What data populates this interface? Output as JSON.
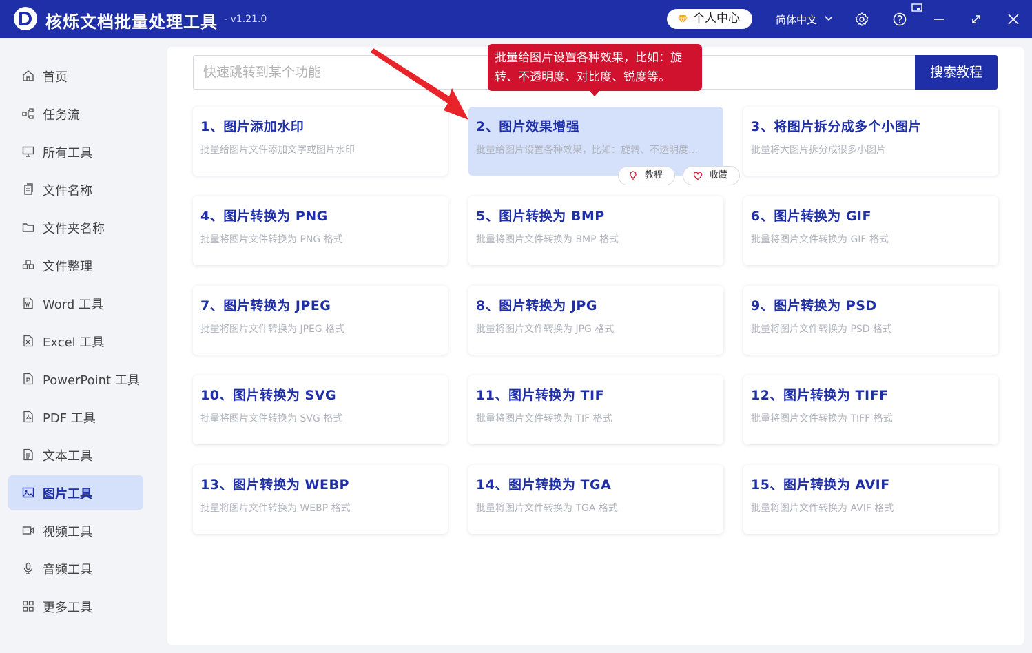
{
  "app": {
    "title": "核烁文档批量处理工具",
    "version": "- v1.21.0",
    "user_center": "个人中心",
    "language": "简体中文"
  },
  "sidebar": {
    "items": [
      {
        "label": "首页",
        "icon": "home-icon"
      },
      {
        "label": "任务流",
        "icon": "workflow-icon"
      },
      {
        "label": "所有工具",
        "icon": "monitor-icon"
      },
      {
        "label": "文件名称",
        "icon": "file-copy-icon"
      },
      {
        "label": "文件夹名称",
        "icon": "folder-icon"
      },
      {
        "label": "文件整理",
        "icon": "organize-icon"
      },
      {
        "label": "Word 工具",
        "icon": "word-icon"
      },
      {
        "label": "Excel 工具",
        "icon": "excel-icon"
      },
      {
        "label": "PowerPoint 工具",
        "icon": "powerpoint-icon"
      },
      {
        "label": "PDF 工具",
        "icon": "pdf-icon"
      },
      {
        "label": "文本工具",
        "icon": "text-icon"
      },
      {
        "label": "图片工具",
        "icon": "image-icon",
        "active": true
      },
      {
        "label": "视频工具",
        "icon": "video-icon"
      },
      {
        "label": "音频工具",
        "icon": "mic-icon"
      },
      {
        "label": "更多工具",
        "icon": "grid-icon"
      }
    ]
  },
  "search": {
    "placeholder": "快速跳转到某个功能",
    "button_label": "搜索教程"
  },
  "tooltip": {
    "line1": "批量给图片设置各种效果，比如：旋",
    "line2": "转、不透明度、对比度、锐度等。"
  },
  "card_actions": {
    "tutorial": "教程",
    "favorite": "收藏"
  },
  "tools": [
    {
      "title": "1、图片添加水印",
      "desc": "批量给图片文件添加文字或图片水印"
    },
    {
      "title": "2、图片效果增强",
      "desc": "批量给图片设置各种效果，比如：旋转、不透明度…",
      "active": true
    },
    {
      "title": "3、将图片拆分成多个小图片",
      "desc": "批量将大图片拆分成很多小图片"
    },
    {
      "title": "4、图片转换为 PNG",
      "desc": "批量将图片文件转换为 PNG 格式"
    },
    {
      "title": "5、图片转换为 BMP",
      "desc": "批量将图片文件转换为 BMP 格式"
    },
    {
      "title": "6、图片转换为 GIF",
      "desc": "批量将图片文件转换为 GIF 格式"
    },
    {
      "title": "7、图片转换为 JPEG",
      "desc": "批量将图片文件转换为 JPEG 格式"
    },
    {
      "title": "8、图片转换为 JPG",
      "desc": "批量将图片文件转换为 JPG 格式"
    },
    {
      "title": "9、图片转换为 PSD",
      "desc": "批量将图片文件转换为 PSD 格式"
    },
    {
      "title": "10、图片转换为 SVG",
      "desc": "批量将图片文件转换为 SVG 格式"
    },
    {
      "title": "11、图片转换为 TIF",
      "desc": "批量将图片文件转换为 TIF 格式"
    },
    {
      "title": "12、图片转换为 TIFF",
      "desc": "批量将图片文件转换为 TIFF 格式"
    },
    {
      "title": "13、图片转换为 WEBP",
      "desc": "批量将图片文件转换为 WEBP 格式"
    },
    {
      "title": "14、图片转换为 TGA",
      "desc": "批量将图片文件转换为 TGA 格式"
    },
    {
      "title": "15、图片转换为 AVIF",
      "desc": "批量将图片文件转换为 AVIF 格式"
    }
  ],
  "colors": {
    "brand": "#1f2fa8",
    "active_bg": "#d5e1fb",
    "tooltip_bg": "#d0122e",
    "arrow": "#e8232a"
  }
}
